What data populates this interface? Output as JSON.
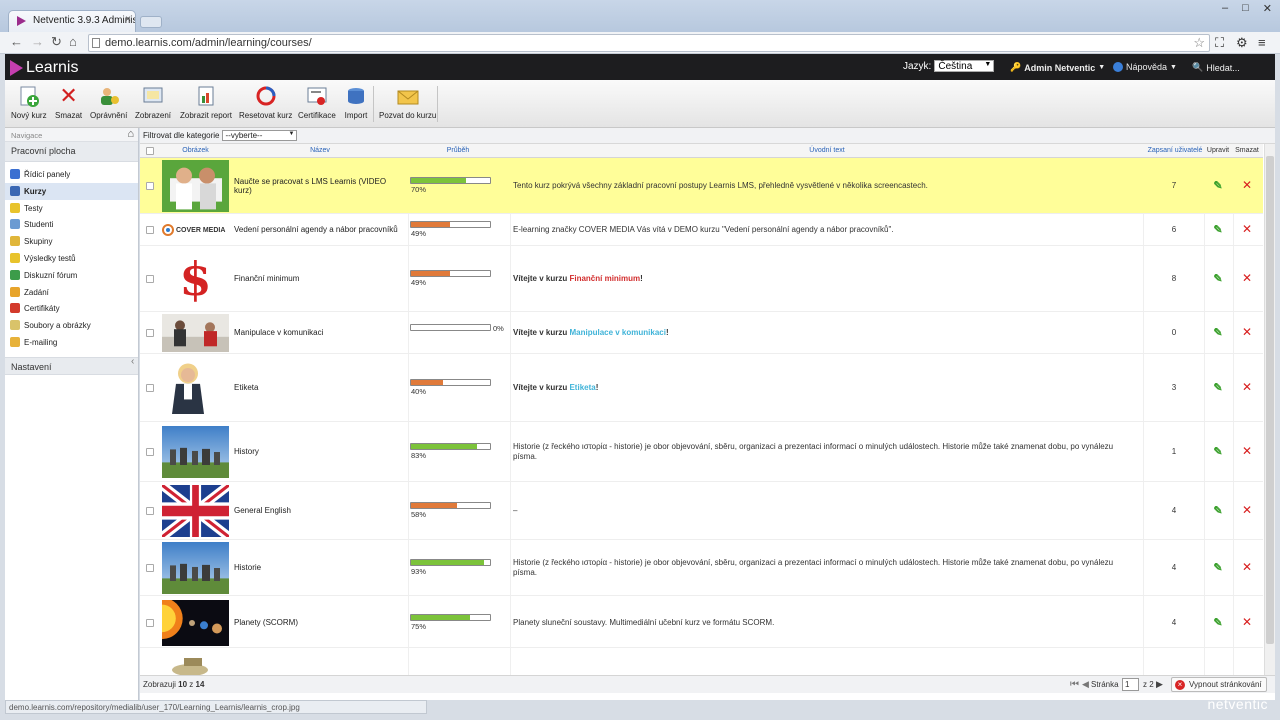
{
  "browser": {
    "tab_title": "Netventic 3.9.3 Administr",
    "tab_close": "×",
    "url": "demo.learnis.com/admin/learning/courses/",
    "window_buttons": [
      "–",
      "□",
      "✕"
    ]
  },
  "app": {
    "logo_text": "Learnis",
    "lang_label": "Jazyk:",
    "lang_value": "Čeština",
    "user": "Admin Netventic",
    "help": "Nápověda",
    "search": "Hledat..."
  },
  "toolbar": [
    {
      "label": "Nový kurz",
      "icon": "new-course-icon"
    },
    {
      "label": "Smazat",
      "icon": "delete-icon"
    },
    {
      "label": "Oprávnění",
      "icon": "permissions-icon"
    },
    {
      "label": "Zobrazení",
      "icon": "view-icon"
    },
    {
      "label": "Zobrazit report",
      "icon": "report-icon"
    },
    {
      "label": "Resetovat kurz",
      "icon": "reset-icon"
    },
    {
      "label": "Certifikace",
      "icon": "certificate-icon"
    },
    {
      "label": "Import",
      "icon": "import-icon"
    },
    {
      "label": "Pozvat do kurzu",
      "icon": "invite-icon"
    }
  ],
  "sidebar": {
    "nav_label": "Navigace",
    "section": "Pracovní plocha",
    "items": [
      {
        "label": "Řídicí panely",
        "color": "#3b6fd1"
      },
      {
        "label": "Kurzy",
        "color": "#3a67b3",
        "active": true
      },
      {
        "label": "Testy",
        "color": "#e8c32c"
      },
      {
        "label": "Studenti",
        "color": "#6c9bd2"
      },
      {
        "label": "Skupiny",
        "color": "#e0b63a"
      },
      {
        "label": "Výsledky testů",
        "color": "#e8c32c"
      },
      {
        "label": "Diskuzní fórum",
        "color": "#3c9c4a"
      },
      {
        "label": "Zadání",
        "color": "#e7a42b"
      },
      {
        "label": "Certifikáty",
        "color": "#d33a2c"
      },
      {
        "label": "Soubory a obrázky",
        "color": "#d9c36a"
      },
      {
        "label": "E-mailing",
        "color": "#e7b23a"
      }
    ],
    "settings": "Nastavení"
  },
  "filter": {
    "label": "Filtrovat dle kategorie",
    "value": "--vyberte--"
  },
  "columns": {
    "image": "Obrázek",
    "name": "Název",
    "progress": "Průběh",
    "intro": "Úvodní text",
    "enrolled": "Zapsaní uživatelé",
    "edit": "Upravit",
    "delete": "Smazat"
  },
  "courses": [
    {
      "name": "Naučte se pracovat s LMS Learnis (VIDEO kurz)",
      "progress": 70,
      "progress_label": "70%",
      "intro": "Tento kurz pokrývá všechny základní pracovní postupy Learnis LMS, přehledně vysvětlené v několika screencastech.",
      "enrolled": "7",
      "thumb": "video-thumb"
    },
    {
      "name": "Vedení personální agendy a nábor pracovníků",
      "progress": 49,
      "progress_label": "49%",
      "intro": "E-learning značky COVER MEDIA Vás vítá v DEMO kurzu \"Vedení personální agendy a nábor pracovníků\".",
      "enrolled": "6",
      "thumb": "cover-media-logo",
      "thumb_text": "COVER MEDIA"
    },
    {
      "name": "Finanční minimum",
      "progress": 49,
      "progress_label": "49%",
      "intro_prefix": "Vítejte v kurzu ",
      "intro_highlight": "Finanční minimum",
      "intro_suffix": "!",
      "highlight_color": "#d22d2d",
      "enrolled": "8",
      "thumb": "dollar-thumb",
      "thumb_text": "$"
    },
    {
      "name": "Manipulace v komunikaci",
      "progress": 0,
      "progress_label": "0%",
      "intro_prefix": "Vítejte v kurzu ",
      "intro_highlight": "Manipulace v komunikaci",
      "intro_suffix": "!",
      "highlight_color": "#3fb3d8",
      "enrolled": "0",
      "thumb": "office-thumb"
    },
    {
      "name": "Etiketa",
      "progress": 40,
      "progress_label": "40%",
      "intro_prefix": "Vítejte v kurzu ",
      "intro_highlight": "Etiketa",
      "intro_suffix": "!",
      "highlight_color": "#3fb3d8",
      "enrolled": "3",
      "thumb": "woman-thumb"
    },
    {
      "name": "History",
      "progress": 83,
      "progress_label": "83%",
      "intro": "Historie (z řeckého ιστορία - historie) je obor objevování, sběru, organizaci a prezentaci informací o minulých událostech. Historie může také znamenat dobu, po vynálezu písma.",
      "enrolled": "1",
      "thumb": "stonehenge-thumb"
    },
    {
      "name": "General English",
      "progress": 58,
      "progress_label": "58%",
      "intro": "–",
      "enrolled": "4",
      "thumb": "uk-flag-thumb"
    },
    {
      "name": "Historie",
      "progress": 93,
      "progress_label": "93%",
      "intro": "Historie (z řeckého ιστορία - historie) je obor objevování, sběru, organizaci a prezentaci informací o minulých událostech. Historie může také znamenat dobu, po vynálezu písma.",
      "enrolled": "4",
      "thumb": "stonehenge-thumb"
    },
    {
      "name": "Planety (SCORM)",
      "progress": 75,
      "progress_label": "75%",
      "intro": "Planety sluneční soustavy. Multimediální učební kurz ve formátu SCORM.",
      "enrolled": "4",
      "thumb": "planets-thumb"
    }
  ],
  "footer": {
    "showing_prefix": "Zobrazuji",
    "showing_count": "10",
    "showing_of": "z",
    "showing_total": "14",
    "page_label": "Stránka",
    "page_value": "1",
    "page_of": "z 2",
    "paging_off": "Vypnout stránkování"
  },
  "status_bar": "demo.learnis.com/repository/medialib/user_170/Learning_Learnis/learnis_crop.jpg",
  "brand": "netventic",
  "colors": {
    "highlight_row": "#fffe99",
    "progress_green": "#7cc33a",
    "progress_orange": "#e07a3a",
    "accent": "#c53eb0"
  }
}
